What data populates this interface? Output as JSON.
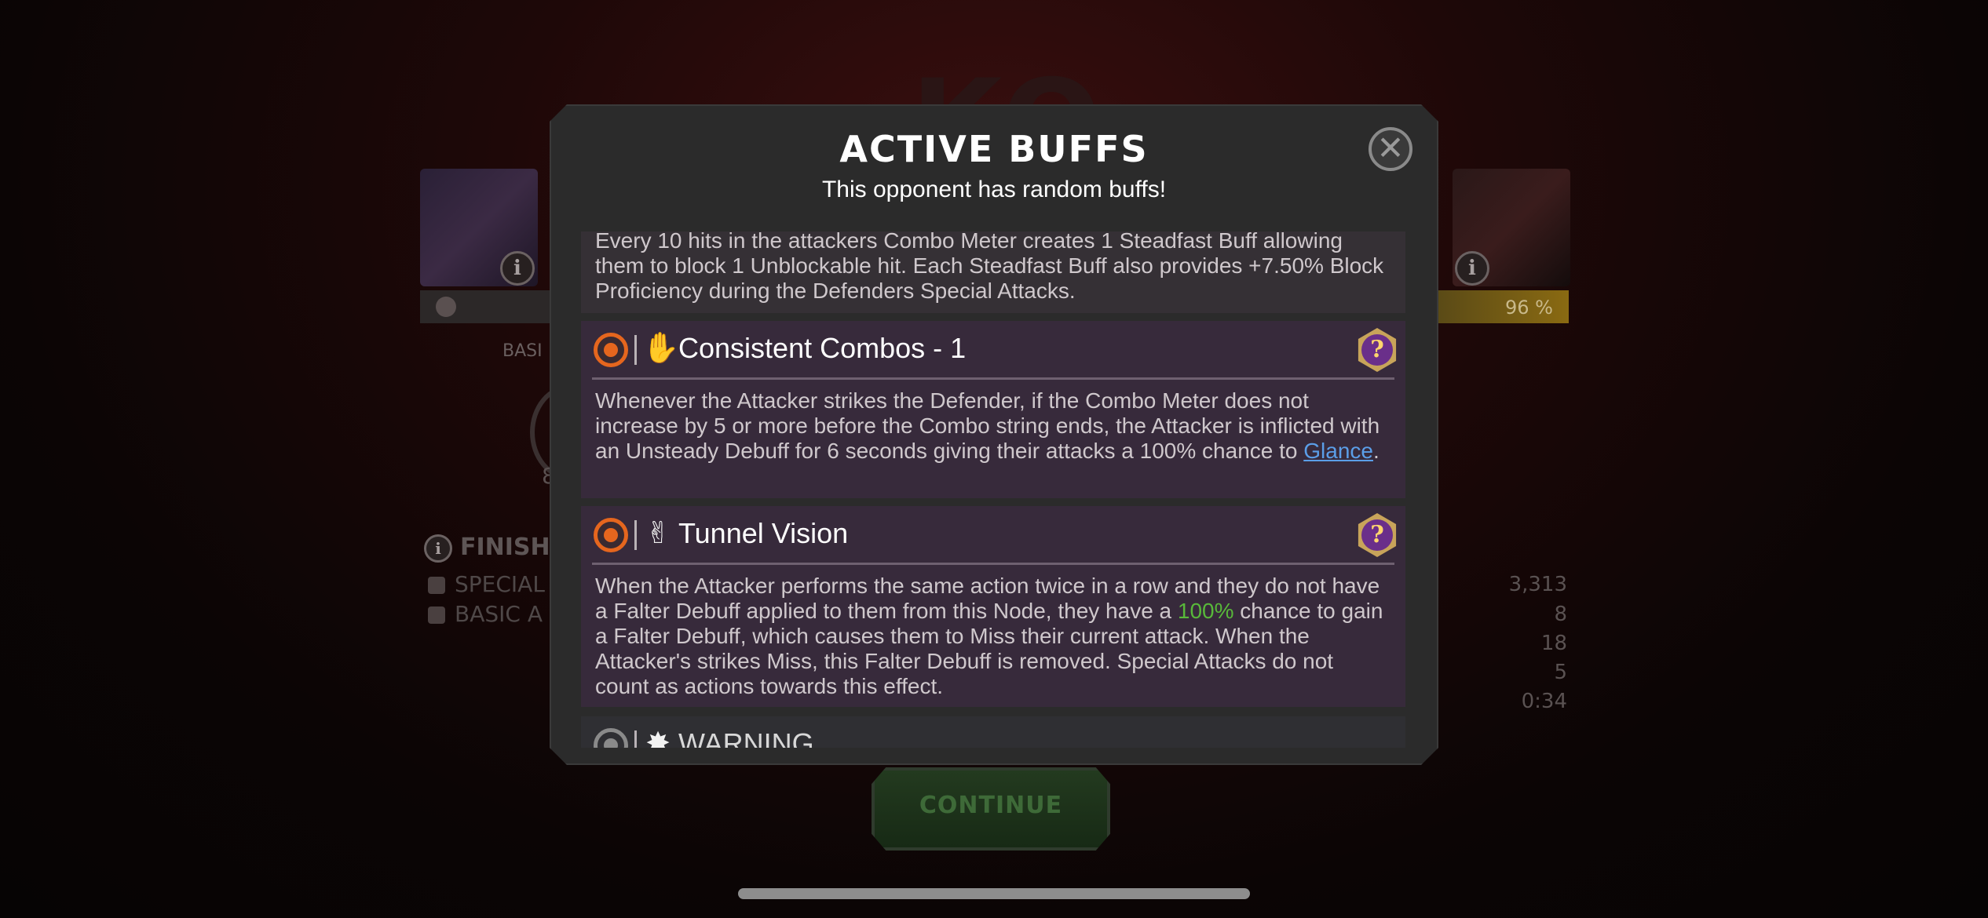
{
  "background": {
    "ko_text": "KO",
    "left_portrait_info": "i",
    "right_portrait_info": "i",
    "right_health_percent": "96 %",
    "basic_label": "BASI",
    "left_number": "8",
    "finish_label": "FINISH",
    "stats": [
      {
        "label": "SPECIAL",
        "value": "3,313"
      },
      {
        "label": "BASIC A",
        "value": "8"
      },
      {
        "label": "",
        "value": "18"
      },
      {
        "label": "",
        "value": "5"
      },
      {
        "label": "",
        "value": "0:34"
      }
    ],
    "continue_label": "CONTINUE"
  },
  "modal": {
    "title": "ACTIVE BUFFS",
    "subtitle": "This opponent has random buffs!",
    "close_glyph": "✕",
    "buffs": [
      {
        "name": "",
        "description": "Every 10 hits in the attackers Combo Meter creates 1 Steadfast Buff allowing them to block 1 Unblockable hit. Each Steadfast Buff also provides +7.50% Block Proficiency during the Defenders Special Attacks."
      },
      {
        "name": "Consistent Combos - 1",
        "glyph": "hand-strike-icon",
        "description_pre": "Whenever the Attacker strikes the Defender, if the Combo Meter does not increase by 5 or more before the Combo string ends, the Attacker is inflicted with an Unsteady Debuff for 6 seconds giving their attacks a 100% chance to ",
        "description_link": "Glance",
        "description_post": "."
      },
      {
        "name": "Tunnel Vision",
        "glyph": "hand-gesture-icon",
        "description_pre": "When the Attacker performs the same action twice in a row and they do not have a Falter Debuff applied to them from this Node, they have a ",
        "description_highlight": "100%",
        "description_post": " chance to gain a Falter Debuff, which causes them to Miss their current attack. When the Attacker's strikes Miss, this Falter Debuff is removed. Special Attacks do not count as actions towards this effect."
      },
      {
        "name": "WARNING"
      }
    ],
    "help_glyph": "?"
  },
  "colors": {
    "accent_orange": "#e5661e",
    "link_blue": "#5b9ee8",
    "highlight_green": "#58b83a",
    "modal_bg": "#2b2b2b",
    "card_bg": "#372a3b"
  }
}
